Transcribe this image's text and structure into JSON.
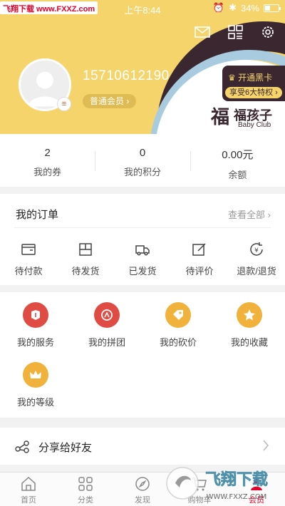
{
  "status_bar": {
    "watermark": "飞翔下载 www.FXXZ.com",
    "time": "上午8:44",
    "battery": "34%",
    "battery_level": 0.34
  },
  "header": {
    "phone": "15710612190",
    "member_level": "普通会员",
    "black_card": {
      "title": "开通黑卡",
      "subtitle": "享受6大特权"
    },
    "brand": {
      "name": "福孩子",
      "sub": "Baby Club"
    },
    "colors": {
      "header_bg": "#f5d46b",
      "dark": "#3a2730",
      "accent_red": "#e4002b"
    }
  },
  "stats": [
    {
      "value": "2",
      "label": "我的券"
    },
    {
      "value": "0",
      "label": "我的积分"
    },
    {
      "value": "0.00元",
      "label": "余额"
    }
  ],
  "orders": {
    "title": "我的订单",
    "view_all": "查看全部",
    "items": [
      {
        "label": "待付款",
        "icon": "wallet-icon"
      },
      {
        "label": "待发货",
        "icon": "box-icon"
      },
      {
        "label": "已发货",
        "icon": "truck-icon"
      },
      {
        "label": "待评价",
        "icon": "edit-icon"
      },
      {
        "label": "退款/退货",
        "icon": "refund-icon"
      }
    ]
  },
  "services": [
    {
      "label": "我的服务",
      "icon": "service-icon",
      "color": "#e04b43"
    },
    {
      "label": "我的拼团",
      "icon": "group-icon",
      "color": "#e04b43"
    },
    {
      "label": "我的砍价",
      "icon": "tag-icon",
      "color": "#f1b23c"
    },
    {
      "label": "我的收藏",
      "icon": "star-icon",
      "color": "#f1b23c"
    },
    {
      "label": "我的等级",
      "icon": "crown-icon",
      "color": "#f1b23c"
    }
  ],
  "share": {
    "label": "分享给好友"
  },
  "tabbar": [
    {
      "label": "首页",
      "icon": "home-icon"
    },
    {
      "label": "分类",
      "icon": "grid-icon"
    },
    {
      "label": "发现",
      "icon": "compass-icon"
    },
    {
      "label": "购物车",
      "icon": "cart-icon"
    },
    {
      "label": "会员",
      "icon": "member-icon",
      "active": true
    }
  ],
  "footer_watermark": "飞翔下载 WWW.FXXZ.COM"
}
